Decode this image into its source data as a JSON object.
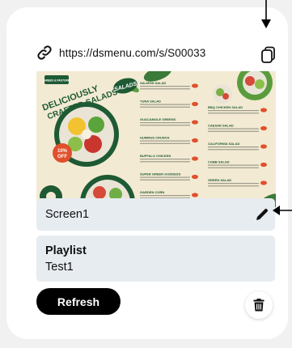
{
  "screen_card": {
    "url": "https://dsmenu.com/s/S00033",
    "name_field": "Screen1",
    "playlist": {
      "label": "Playlist",
      "value": "Test1"
    },
    "refresh_label": "Refresh",
    "icons": {
      "link": "link-icon",
      "copy": "copy-icon",
      "edit": "pencil-icon",
      "delete": "trash-icon"
    }
  },
  "menu_preview": {
    "brand": "GREEN & PASTURE",
    "headline": "DELICIOUSLY CRAFTED SALADS",
    "badge": "SALADS",
    "discount": "10% OFF",
    "circle_text": "Crafting Exceptional Gastronomy & Culinary Delights",
    "left_items": [
      "SALMON SALAD",
      "TUNA SALAD",
      "GUACAMOLE GREENS",
      "HUMMUS CRUNCH",
      "BUFFALO CHICKEN",
      "SUPER GREEN GODDESS",
      "GARDEN CORN"
    ],
    "right_items": [
      "BBQ CHICKEN SALAD",
      "CAESAR SALAD",
      "CALIFORNIA SALAD",
      "COBB SALAD",
      "GREEN SALAD"
    ],
    "colors": {
      "background": "#f3ead3",
      "green": "#1e5a34",
      "accent": "#e0502c"
    }
  },
  "annotations": {
    "arrow_top": "down-arrow-icon",
    "arrow_right": "left-arrow-icon"
  }
}
